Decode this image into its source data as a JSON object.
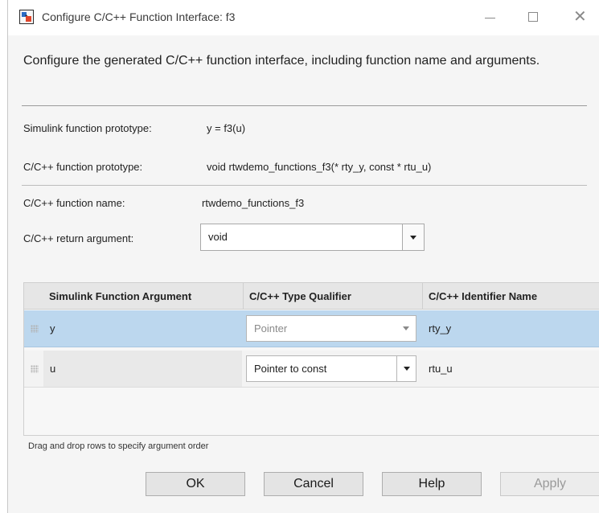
{
  "window": {
    "title": "Configure C/C++ Function Interface: f3",
    "icon": "simulink-app-icon",
    "controls": [
      "minimize-icon",
      "maximize-icon",
      "close-icon"
    ]
  },
  "description": "Configure the generated C/C++ function interface, including function name and arguments.",
  "prototypes": {
    "simulink_label": "Simulink function prototype:",
    "simulink_value": "y = f3(u)",
    "cpp_label": "C/C++ function prototype:",
    "cpp_value": "void rtwdemo_functions_f3(* rty_y, const * rtu_u)"
  },
  "function_name": {
    "label": "C/C++ function name:",
    "value": "rtwdemo_functions_f3"
  },
  "return_argument": {
    "label": "C/C++ return argument:",
    "value": "void"
  },
  "table": {
    "columns": [
      "Simulink Function Argument",
      "C/C++ Type Qualifier",
      "C/C++ Identifier Name"
    ],
    "rows": [
      {
        "argument": "y",
        "qualifier": "Pointer",
        "identifier": "rty_y",
        "selected": true,
        "qualifier_enabled": false
      },
      {
        "argument": "u",
        "qualifier": "Pointer to const",
        "identifier": "rtu_u",
        "selected": false,
        "qualifier_enabled": true
      }
    ]
  },
  "hint": "Drag and drop rows to specify argument order",
  "buttons": {
    "ok": "OK",
    "cancel": "Cancel",
    "help": "Help",
    "apply": "Apply"
  },
  "colors": {
    "selected_row": "#bcd7ee",
    "header_bg": "#e6e6e6",
    "dialog_bg": "#f5f5f5"
  }
}
